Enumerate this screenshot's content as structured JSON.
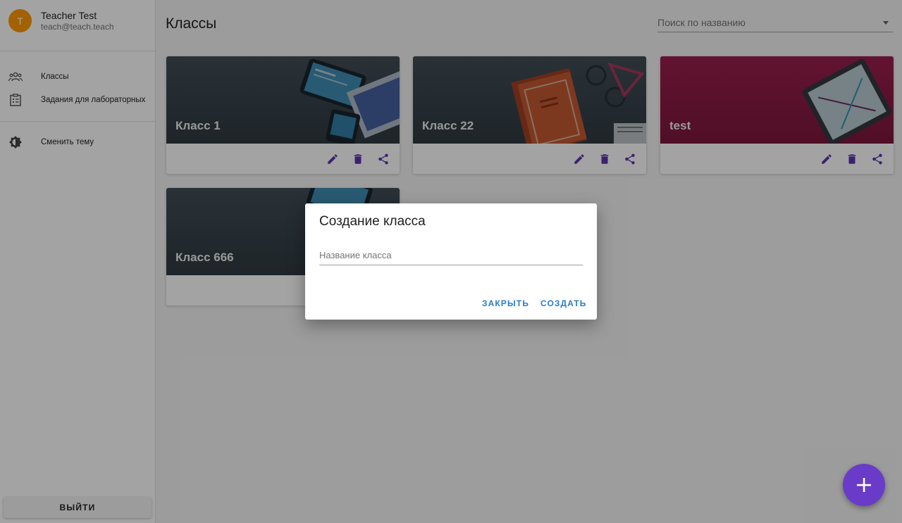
{
  "user": {
    "avatar_letter": "T",
    "name": "Teacher Test",
    "email": "teach@teach.teach"
  },
  "sidebar": {
    "items": [
      {
        "label": "Классы",
        "icon": "people-icon"
      },
      {
        "label": "Задания для лабораторных",
        "icon": "clipboard-icon"
      },
      {
        "label": "Сменить тему",
        "icon": "brightness-icon"
      }
    ],
    "logout_label": "ВЫЙТИ"
  },
  "header": {
    "title": "Классы",
    "search_placeholder": "Поиск по названию"
  },
  "classes": [
    {
      "name": "Класс 1",
      "theme": "tech"
    },
    {
      "name": "Класс 22",
      "theme": "books"
    },
    {
      "name": "test",
      "theme": "pink"
    },
    {
      "name": "Класс 666",
      "theme": "tech"
    }
  ],
  "dialog": {
    "title": "Создание класса",
    "input_label": "Название класса",
    "input_value": "",
    "close_label": "ЗАКРЫТЬ",
    "create_label": "СОЗДАТЬ"
  },
  "colors": {
    "accent": "#6a3bc8",
    "action_icon": "#5e35b1",
    "dialog_button": "#2a7cc7",
    "avatar": "#ff9800"
  }
}
